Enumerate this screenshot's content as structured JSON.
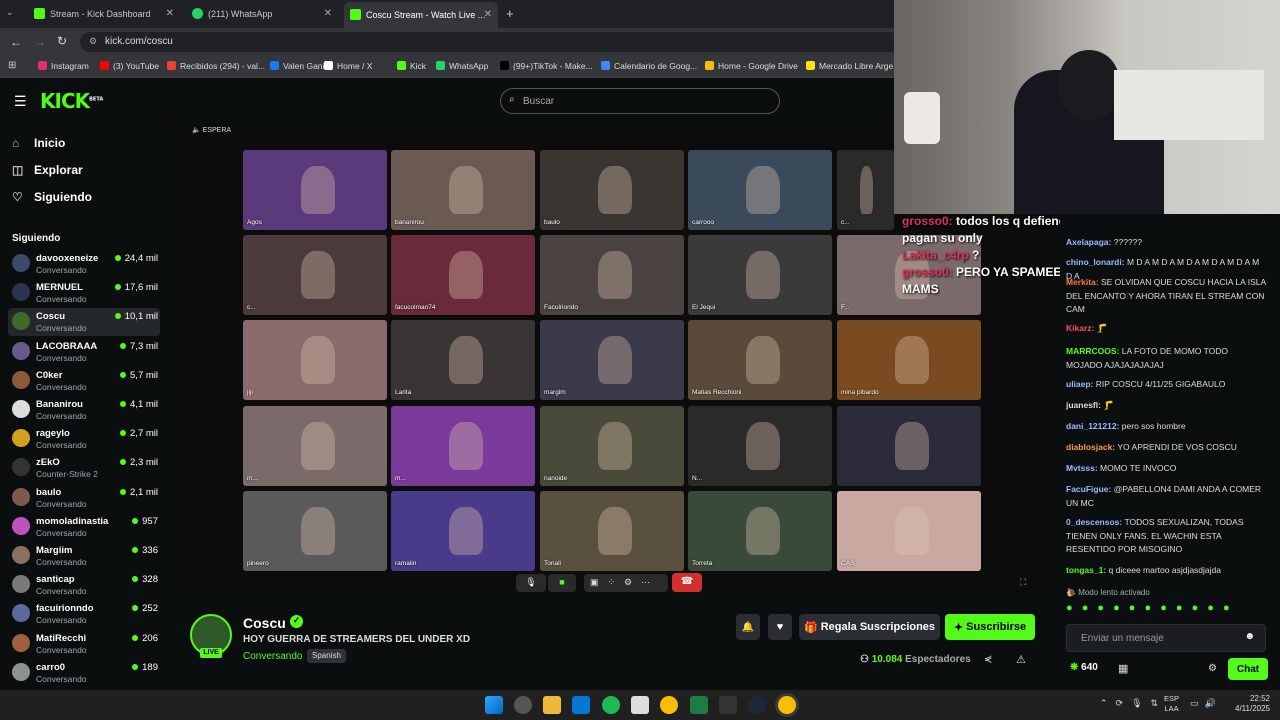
{
  "browser": {
    "tabs": [
      {
        "label": "Stream - Kick Dashboard",
        "color": "#53fc18"
      },
      {
        "label": "(211) WhatsApp",
        "color": "#25d366"
      },
      {
        "label": "Coscu Stream - Watch Live ...",
        "color": "#53fc18"
      }
    ],
    "url": "kick.com/coscu",
    "bookmarks": [
      {
        "label": "Instagram",
        "color": "#e1306c"
      },
      {
        "label": "(3) YouTube",
        "color": "#ff0000"
      },
      {
        "label": "Recibidos (294) - val...",
        "color": "#ea4335"
      },
      {
        "label": "Valen Ganin",
        "color": "#1877f2"
      },
      {
        "label": "Home / X",
        "color": "#ffffff"
      },
      {
        "label": "Kick",
        "color": "#53fc18"
      },
      {
        "label": "WhatsApp",
        "color": "#25d366"
      },
      {
        "label": "(99+)TikTok - Make...",
        "color": "#000000"
      },
      {
        "label": "Calendario de Goog...",
        "color": "#4285f4"
      },
      {
        "label": "Home - Google Drive",
        "color": "#fbbc04"
      },
      {
        "label": "Mercado Libre Arge...",
        "color": "#ffe600"
      }
    ]
  },
  "kick": {
    "logo": "KICK",
    "logo_badge": "BETA",
    "search_placeholder": "Buscar",
    "nav": [
      {
        "label": "Inicio",
        "icon": "⌂"
      },
      {
        "label": "Explorar",
        "icon": "◫"
      },
      {
        "label": "Siguiendo",
        "icon": "♡"
      }
    ],
    "following_title": "Siguiendo",
    "following": [
      {
        "name": "davooxeneize",
        "game": "Conversando",
        "viewers": "24,4 mil",
        "color": "#3a4a6a"
      },
      {
        "name": "MERNUEL",
        "game": "Conversando",
        "viewers": "17,6 mil",
        "color": "#2a3550"
      },
      {
        "name": "Coscu",
        "game": "Conversando",
        "viewers": "10,1 mil",
        "color": "#3e6b2a"
      },
      {
        "name": "LACOBRAAA",
        "game": "Conversando",
        "viewers": "7,3 mil",
        "color": "#6a5a8a"
      },
      {
        "name": "C0ker",
        "game": "Conversando",
        "viewers": "5,7 mil",
        "color": "#8a5a3a"
      },
      {
        "name": "Bananirou",
        "game": "Conversando",
        "viewers": "4,1 mil",
        "color": "#ddd"
      },
      {
        "name": "rageylo",
        "game": "Conversando",
        "viewers": "2,7 mil",
        "color": "#d4a020"
      },
      {
        "name": "zEkO",
        "game": "Counter-Strike 2",
        "viewers": "2,3 mil",
        "color": "#333"
      },
      {
        "name": "baulo",
        "game": "Conversando",
        "viewers": "2,1 mil",
        "color": "#7a5a4a"
      },
      {
        "name": "momoladinastia",
        "game": "Conversando",
        "viewers": "957",
        "color": "#c050c0"
      },
      {
        "name": "Margiim",
        "game": "Conversando",
        "viewers": "336",
        "color": "#8a7060"
      },
      {
        "name": "santicap",
        "game": "Conversando",
        "viewers": "328",
        "color": "#7a7a7a"
      },
      {
        "name": "facuirionndo",
        "game": "Conversando",
        "viewers": "252",
        "color": "#5a6a9a"
      },
      {
        "name": "MatiRecchi",
        "game": "Conversando",
        "viewers": "206",
        "color": "#a06040"
      },
      {
        "name": "carro0",
        "game": "Conversando",
        "viewers": "189",
        "color": "#909090"
      }
    ],
    "stage_label": "ESPERA",
    "participants": [
      "Agos",
      "bananirou",
      "baulo",
      "carrooo",
      "c...",
      "c...",
      "facucolman74",
      "Faculriondo",
      "El Jequi",
      "F...",
      "jiji",
      "Larita",
      "margim",
      "Matias Recchioni",
      "mina pibardo",
      "m...",
      "m...",
      "nanoide",
      "N...",
      "",
      "pineero",
      "ramaiin",
      "Tonali",
      "Torreta",
      "CAS"
    ],
    "overlay_msgs": [
      {
        "user": "grosso0:",
        "text": "todos los q defienden cam nair son unos pajines q pagan su only"
      },
      {
        "user": "Lakita_c4rp",
        "text": "?"
      },
      {
        "user": "grosso0:",
        "text": "PERO YA SPAMEE AMIGO NO ME DEJA MANDAR MAMS"
      }
    ],
    "chat": [
      {
        "user": "Axelapaga:",
        "text": "??????",
        "color": "#9db8ff"
      },
      {
        "user": "chino_lonardi:",
        "text": "M D A M D A M D A M D A M D A M D A",
        "color": "#9db8ff"
      },
      {
        "user": "Merkita:",
        "text": "SE OLVIDAN QUE COSCU HACIA LA ISLA DEL ENCANTO Y AHORA TIRAN EL STREAM CON CAM",
        "color": "#ff7a3a"
      },
      {
        "user": "Kikarz:",
        "text": "🦵",
        "color": "#ff4a6a"
      },
      {
        "user": "MARRCOOS:",
        "text": "LA FOTO DE MOMO TODO MOJADO AJAJAJAJAJAJ",
        "color": "#53fc18"
      },
      {
        "user": "uliaep:",
        "text": "RIP COSCU 4/11/25 GIGABAULO",
        "color": "#9db8ff"
      },
      {
        "user": "juanesfl:",
        "text": "🦵",
        "color": "#ddd"
      },
      {
        "user": "dani_121212:",
        "text": "pero sos hombre",
        "color": "#9db8ff"
      },
      {
        "user": "diablosjack:",
        "text": "YO APRENDI DE VOS COSCU",
        "color": "#ff9a3a"
      },
      {
        "user": "Mvtsss:",
        "text": "MOMO TE INVOCO",
        "color": "#9db8ff"
      },
      {
        "user": "FacuFigue:",
        "text": "@PABELLON4 DAMI ANDA A COMER UN MC",
        "color": "#9db8ff"
      },
      {
        "user": "0_descensos:",
        "text": "TODOS SEXUALIZAN, TODAS TIENEN ONLY FANS. EL WACHIN ESTA RESENTIDO POR MISOGINO",
        "color": "#9db8ff"
      },
      {
        "user": "tongas_1:",
        "text": "q diceee martoo asjdjasdjajda",
        "color": "#53fc18"
      }
    ],
    "slow_mode": "Modo lento activado",
    "chat_placeholder": "Enviar un mensaje",
    "points": "640",
    "chat_button": "Chat",
    "streamer": {
      "name": "Coscu",
      "title": "HOY GUERRA DE STREAMERS DEL UNDER XD",
      "category": "Conversando",
      "language": "Spanish",
      "live": "LIVE",
      "viewers": "10.084",
      "viewers_label": "Espectadores"
    },
    "gift_button": "Regala Suscripciones",
    "subscribe_button": "Suscribirse"
  },
  "taskbar": {
    "lang1": "ESP",
    "lang2": "LAA",
    "time": "22:52",
    "date": "4/11/2025"
  }
}
